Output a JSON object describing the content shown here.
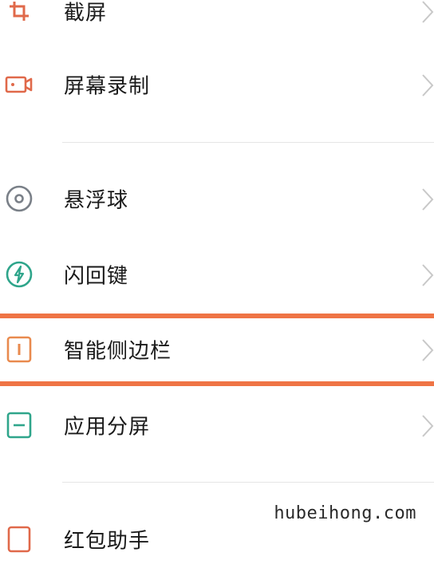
{
  "menu": {
    "items": [
      {
        "label": "截屏",
        "icon": "crop-icon",
        "color": "#e0694a"
      },
      {
        "label": "屏幕录制",
        "icon": "video-record-icon",
        "color": "#e0694a"
      },
      {
        "label": "悬浮球",
        "icon": "floating-ball-icon",
        "color": "#7a8088"
      },
      {
        "label": "闪回键",
        "icon": "flashback-icon",
        "color": "#2fa58b"
      },
      {
        "label": "智能侧边栏",
        "icon": "sidebar-icon",
        "color": "#e98a4e"
      },
      {
        "label": "应用分屏",
        "icon": "split-screen-icon",
        "color": "#2fa58b"
      },
      {
        "label": "红包助手",
        "icon": "red-packet-icon",
        "color": "#e0694a"
      }
    ]
  },
  "highlight_color": "#ef7445",
  "watermark": "hubeihong.com"
}
